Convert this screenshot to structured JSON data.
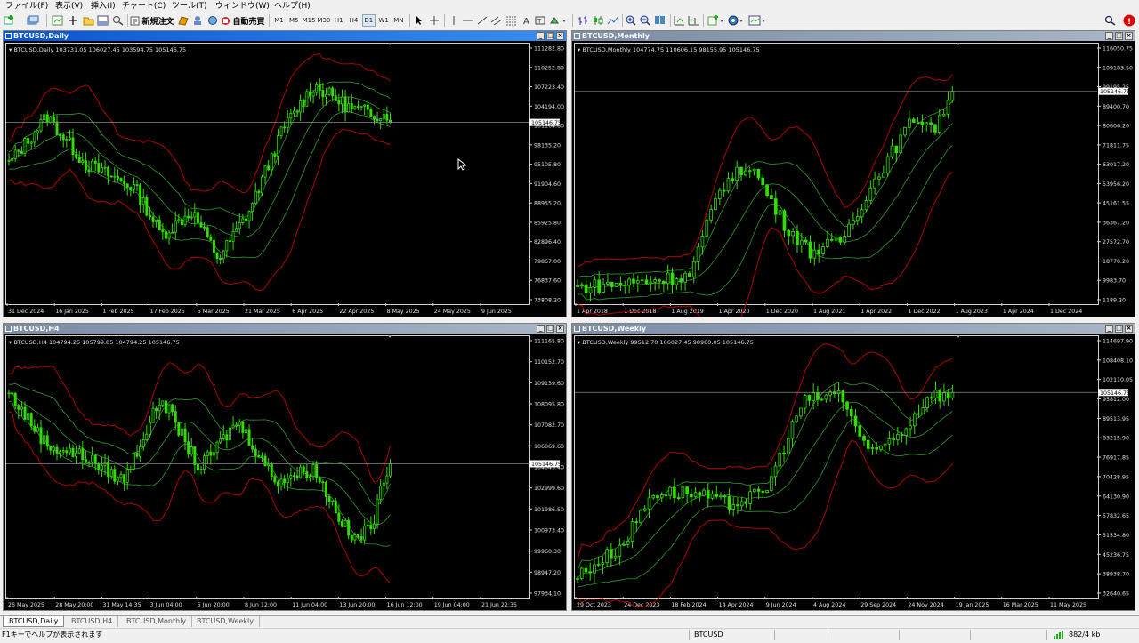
{
  "menu": [
    "ファイル(F)",
    "表示(V)",
    "挿入(I)",
    "チャート(C)",
    "ツール(T)",
    "ウィンドウ(W)",
    "ヘルプ(H)"
  ],
  "toolbar": {
    "new_order": "新規注文",
    "auto_trading": "自動売買",
    "timeframes": [
      "M1",
      "M5",
      "M15",
      "M30",
      "H1",
      "H4",
      "D1",
      "W1",
      "MN"
    ],
    "active_timeframe": "D1",
    "icons": [
      "new-chart-icon",
      "profiles-icon",
      "market-watch-icon",
      "data-window-icon",
      "navigator-icon",
      "terminal-icon",
      "strategy-tester-icon",
      "cursor-icon",
      "crosshair-icon",
      "vertical-line-icon",
      "horizontal-line-icon",
      "trendline-icon",
      "channel-icon",
      "fibonacci-icon",
      "text-icon",
      "label-icon",
      "shapes-icon",
      "bar-chart-icon",
      "candlestick-icon",
      "line-chart-icon",
      "zoom-in-icon",
      "zoom-out-icon",
      "tile-windows-icon",
      "autoscroll-icon",
      "chart-shift-icon",
      "indicators-icon",
      "periodicity-icon",
      "templates-icon",
      "search-icon",
      "notification-icon"
    ]
  },
  "charts": [
    {
      "title": "BTCUSD,Daily",
      "header": "BTCUSD,Daily  103731.05 106027.45 103594.75 105146.75",
      "active": true,
      "price": "105146.75",
      "y_ticks": [
        "111282.80",
        "110252.80",
        "107223.40",
        "104194.00",
        "101164.60",
        "98135.20",
        "95105.80",
        "91904.60",
        "88955.20",
        "85925.80",
        "82896.40",
        "79867.00",
        "76837.60",
        "73808.20"
      ],
      "x_ticks": [
        "31 Dec 2024",
        "16 Jan 2025",
        "1 Feb 2025",
        "17 Feb 2025",
        "5 Mar 2025",
        "21 Mar 2025",
        "6 Apr 2025",
        "22 Apr 2025",
        "8 May 2025",
        "24 May 2025",
        "9 Jun 2025"
      ],
      "colors": {
        "candle": "#33dd00",
        "outer_band": "#b00000",
        "inner_band": "#2e9a2e",
        "price_line": "#8a8a8a",
        "axis": "#cfcfcf"
      }
    },
    {
      "title": "BTCUSD,Monthly",
      "header": "BTCUSD,Monthly  104774.75 110606.15 98155.95 105146.75",
      "active": false,
      "price": "105146.75",
      "y_ticks": [
        "116050.75",
        "109183.50",
        "99195.25",
        "89400.70",
        "80606.20",
        "71811.75",
        "63017.20",
        "53956.20",
        "45161.55",
        "36367.20",
        "27572.70",
        "18770.20",
        "9983.70",
        "1189.20"
      ],
      "x_ticks": [
        "1 Apr 2018",
        "1 Dec 2018",
        "1 Aug 2019",
        "1 Apr 2020",
        "1 Dec 2020",
        "1 Aug 2021",
        "1 Apr 2022",
        "1 Dec 2022",
        "1 Aug 2023",
        "1 Apr 2024",
        "1 Dec 2024"
      ],
      "colors": {
        "candle": "#33dd00",
        "outer_band": "#b00000",
        "inner_band": "#2e9a2e",
        "price_line": "#8a8a8a",
        "axis": "#cfcfcf"
      }
    },
    {
      "title": "BTCUSD,H4",
      "header": "BTCUSD,H4  104794.25 105799.85 104794.25 105146.75",
      "active": false,
      "price": "105146.75",
      "y_ticks": [
        "111165.80",
        "110152.70",
        "109139.60",
        "108095.80",
        "107082.70",
        "106069.60",
        "104043.40",
        "102999.60",
        "101986.50",
        "100973.40",
        "99960.30",
        "98947.20",
        "97934.10"
      ],
      "x_ticks": [
        "26 May 2025",
        "28 May 20:00",
        "31 May 14:35",
        "3 Jun 04:00",
        "5 Jun 20:00",
        "8 Jun 12:00",
        "11 Jun 04:00",
        "13 Jun 20:00",
        "16 Jun 12:00",
        "19 Jun 04:00",
        "21 Jun 22:35"
      ],
      "colors": {
        "candle": "#33dd00",
        "outer_band": "#b00000",
        "inner_band": "#2e9a2e",
        "price_line": "#8a8a8a",
        "axis": "#cfcfcf"
      }
    },
    {
      "title": "BTCUSD,Weekly",
      "header": "BTCUSD,Weekly  99512.70 106027.45 98980.05 105146.75",
      "active": false,
      "price": "105146.75",
      "y_ticks": [
        "114697.90",
        "108408.10",
        "102110.05",
        "95812.00",
        "89513.95",
        "83215.90",
        "76917.85",
        "70428.95",
        "64130.90",
        "57832.65",
        "51534.80",
        "45236.75",
        "38938.70",
        "32640.65"
      ],
      "x_ticks": [
        "29 Oct 2023",
        "24 Dec 2023",
        "18 Feb 2024",
        "14 Apr 2024",
        "9 Jun 2024",
        "4 Aug 2024",
        "29 Sep 2024",
        "24 Nov 2024",
        "19 Jan 2025",
        "16 Mar 2025",
        "11 May 2025"
      ],
      "colors": {
        "candle": "#33dd00",
        "outer_band": "#b00000",
        "inner_band": "#2e9a2e",
        "price_line": "#8a8a8a",
        "axis": "#cfcfcf"
      }
    }
  ],
  "tabs": [
    "BTCUSD,Daily",
    "BTCUSD,H4",
    "BTCUSD,Monthly",
    "BTCUSD,Weekly"
  ],
  "active_tab": "BTCUSD,Daily",
  "status": {
    "help": "F1キーでヘルプが表示されます",
    "symbol": "BTCUSD",
    "traffic": "882/4 kb"
  }
}
